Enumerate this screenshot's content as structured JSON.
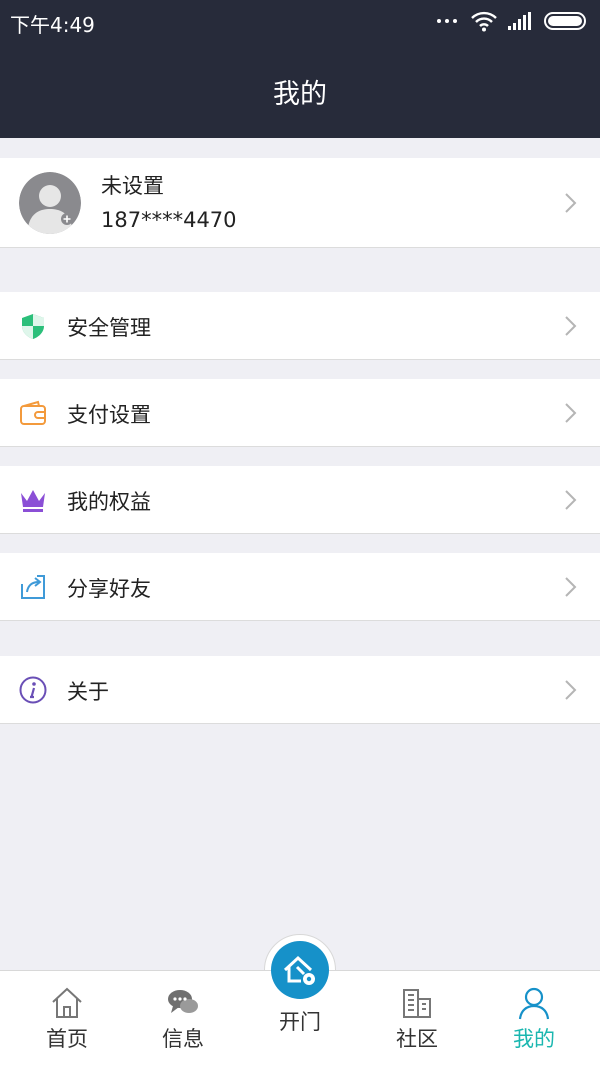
{
  "status_bar": {
    "time": "下午4:49"
  },
  "header": {
    "title": "我的"
  },
  "profile": {
    "name": "未设置",
    "phone": "187****4470",
    "avatar_icon": "avatar-placeholder-icon"
  },
  "menu": {
    "items": [
      {
        "label": "安全管理",
        "icon": "shield-icon",
        "color": "#2bbf7a"
      },
      {
        "label": "支付设置",
        "icon": "wallet-icon",
        "color": "#f39a3c"
      },
      {
        "label": "我的权益",
        "icon": "crown-icon",
        "color": "#8b4fd6"
      },
      {
        "label": "分享好友",
        "icon": "share-icon",
        "color": "#3f9ad8"
      },
      {
        "label": "关于",
        "icon": "info-icon",
        "color": "#6a4fb6"
      }
    ]
  },
  "tab_bar": {
    "tabs": [
      {
        "label": "首页",
        "icon": "home-icon"
      },
      {
        "label": "信息",
        "icon": "chat-icon"
      },
      {
        "label": "开门",
        "icon": "open-door-icon"
      },
      {
        "label": "社区",
        "icon": "building-icon"
      },
      {
        "label": "我的",
        "icon": "user-icon",
        "active": true
      }
    ]
  },
  "colors": {
    "header_bg": "#272b3a",
    "page_bg": "#efeff4",
    "accent": "#1bb7b0",
    "open_door": "#1691c9"
  }
}
